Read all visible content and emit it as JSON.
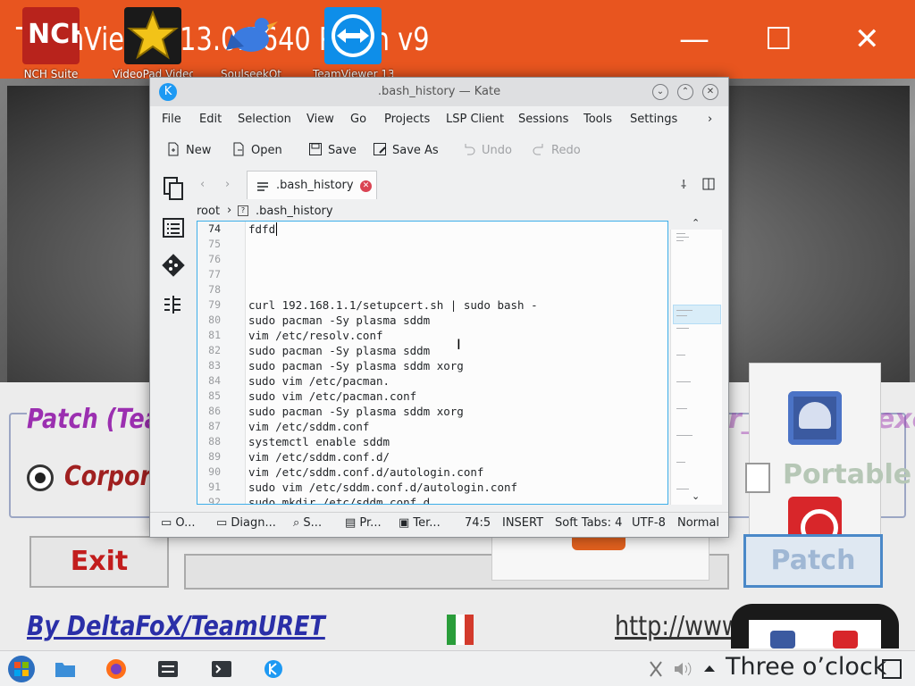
{
  "background_app": {
    "title": "TeamViewer 13.0.5640 Patch v9",
    "patch_label": "Patch (Team",
    "patch_label_right": "r_Service.exe)",
    "radio_label": "Corpora",
    "exit_label": "Exit",
    "credit": "By DeltaFoX/TeamURET",
    "link": "http://www.",
    "portable_label": "Portable",
    "patch_button": "Patch",
    "minimize": "—",
    "maximize": "☐",
    "close": "✕"
  },
  "desktop_icons": [
    {
      "label": "NCH Suite",
      "icon": "nch-suite-icon",
      "color": "#b8231c"
    },
    {
      "label": "VideoPad Video Ed",
      "icon": "videopad-star-icon",
      "color": "#1a1a1a"
    },
    {
      "label": "SoulseekQt",
      "icon": "soulseek-bird-icon",
      "color": "#3b7be0"
    },
    {
      "label": "TeamViewer 13",
      "icon": "teamviewer-icon",
      "color": "#0e8ee9"
    }
  ],
  "kate": {
    "title": ".bash_history — Kate",
    "menu": [
      "File",
      "Edit",
      "Selection",
      "View",
      "Go",
      "Projects",
      "LSP Client",
      "Sessions",
      "Tools",
      "Settings"
    ],
    "menu_more": "›",
    "toolbar": {
      "new": "New",
      "open": "Open",
      "save": "Save",
      "save_as": "Save As",
      "undo": "Undo",
      "redo": "Redo"
    },
    "tab": {
      "label": ".bash_history",
      "close": "✕"
    },
    "breadcrumb": {
      "root": "root",
      "sep": "›",
      "file": ".bash_history"
    },
    "lines": [
      {
        "n": "74",
        "text": "fdfd"
      },
      {
        "n": "75",
        "text": ""
      },
      {
        "n": "76",
        "text": ""
      },
      {
        "n": "77",
        "text": ""
      },
      {
        "n": "78",
        "text": ""
      },
      {
        "n": "79",
        "text": "curl 192.168.1.1/setupcert.sh | sudo bash -"
      },
      {
        "n": "80",
        "text": "sudo pacman -Sy plasma sddm"
      },
      {
        "n": "81",
        "text": "vim /etc/resolv.conf"
      },
      {
        "n": "82",
        "text": "sudo pacman -Sy plasma sddm"
      },
      {
        "n": "83",
        "text": "sudo pacman -Sy plasma sddm xorg"
      },
      {
        "n": "84",
        "text": "sudo vim /etc/pacman."
      },
      {
        "n": "85",
        "text": "sudo vim /etc/pacman.conf"
      },
      {
        "n": "86",
        "text": "sudo pacman -Sy plasma sddm xorg"
      },
      {
        "n": "87",
        "text": "vim /etc/sddm.conf"
      },
      {
        "n": "88",
        "text": "systemctl enable sddm"
      },
      {
        "n": "89",
        "text": "vim /etc/sddm.conf.d/"
      },
      {
        "n": "90",
        "text": "vim /etc/sddm.conf.d/autologin.conf"
      },
      {
        "n": "91",
        "text": "sudo vim /etc/sddm.conf.d/autologin.conf"
      },
      {
        "n": "92",
        "text": "sudo mkdir /etc/sddm.conf.d"
      }
    ],
    "status": {
      "output": "O...",
      "diagnostics": "Diagn...",
      "search": "S...",
      "projects": "Pr...",
      "terminal": "Ter...",
      "cursor": "74:5",
      "mode": "INSERT",
      "tabs": "Soft Tabs: 4",
      "encoding": "UTF-8",
      "highlight": "Normal"
    }
  },
  "taskbar": {
    "clock": "Three o’clock"
  }
}
